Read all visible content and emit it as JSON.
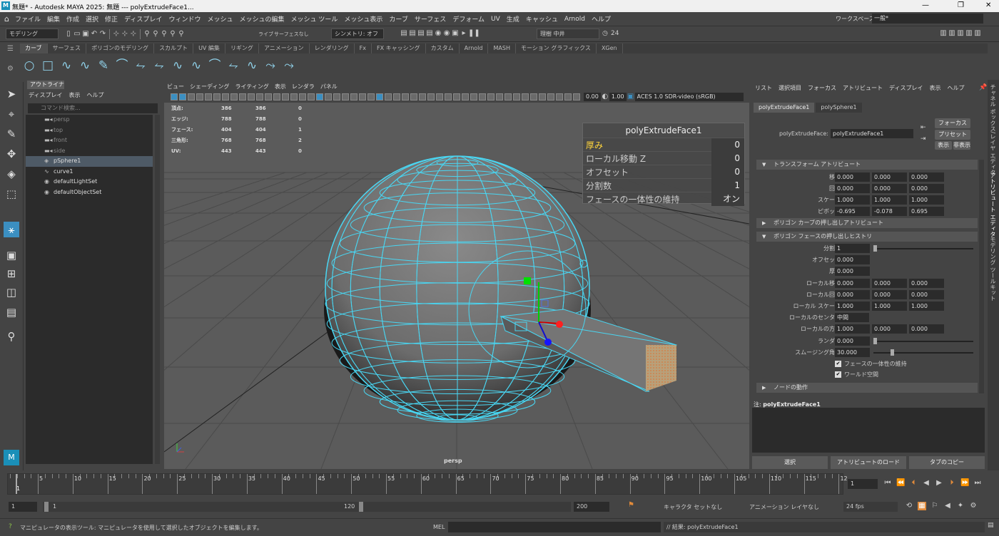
{
  "window": {
    "title": "無題* - Autodesk MAYA 2025: 無題   ---   polyExtrudeFace1...",
    "logo": "M",
    "min": "—",
    "max": "❐",
    "close": "✕"
  },
  "menubar": [
    "ファイル",
    "編集",
    "作成",
    "選択",
    "修正",
    "ディスプレイ",
    "ウィンドウ",
    "メッシュ",
    "メッシュの編集",
    "メッシュ ツール",
    "メッシュ表示",
    "カーブ",
    "サーフェス",
    "デフォーム",
    "UV",
    "生成",
    "キャッシュ",
    "Arnold",
    "ヘルプ"
  ],
  "workspace": {
    "label": "ワークスペース :",
    "value": "一般*"
  },
  "statusline": {
    "menuset": "モデリング",
    "live": "ライブ",
    "live_value": "サーフェスなし",
    "symmetry": "シンメトリ: オフ",
    "user": "理樹 中井",
    "count": "24"
  },
  "shelf": {
    "tabs": [
      "カーブ",
      "サーフェス",
      "ポリゴンのモデリング",
      "スカルプト",
      "UV 編集",
      "リギング",
      "アニメーション",
      "レンダリング",
      "Fx",
      "FX キャッシング",
      "カスタム",
      "Arnold",
      "MASH",
      "モーション グラフィックス",
      "XGen"
    ]
  },
  "outliner": {
    "tab": "アウトライナ",
    "menus": [
      "ディスプレイ",
      "表示",
      "ヘルプ"
    ],
    "search_placeholder": "コマンド検索...",
    "items": [
      {
        "name": "persp",
        "dim": true
      },
      {
        "name": "top",
        "dim": true
      },
      {
        "name": "front",
        "dim": true
      },
      {
        "name": "side",
        "dim": true
      },
      {
        "name": "pSphere1",
        "dim": false,
        "selected": true
      },
      {
        "name": "curve1",
        "dim": false
      },
      {
        "name": "defaultLightSet",
        "dim": false
      },
      {
        "name": "defaultObjectSet",
        "dim": false
      }
    ]
  },
  "viewport": {
    "menus": [
      "ビュー",
      "シェーディング",
      "ライティング",
      "表示",
      "レンダラ",
      "パネル"
    ],
    "exposure": "0.00",
    "gamma": "1.00",
    "colorspace": "ACES 1.0 SDR-video (sRGB)",
    "camera": "persp",
    "hud": [
      [
        "頂点:",
        "386",
        "386",
        "0"
      ],
      [
        "エッジ:",
        "788",
        "788",
        "0"
      ],
      [
        "フェース:",
        "404",
        "404",
        "1"
      ],
      [
        "三角形:",
        "768",
        "768",
        "2"
      ],
      [
        "UV:",
        "443",
        "443",
        "0"
      ]
    ]
  },
  "inview_editor": {
    "title": "polyExtrudeFace1",
    "rows": [
      {
        "label": "厚み",
        "value": "0",
        "highlight": true
      },
      {
        "label": "ローカル移動 Z",
        "value": "0"
      },
      {
        "label": "オフセット",
        "value": "0"
      },
      {
        "label": "分割数",
        "value": "1"
      },
      {
        "label": "フェースの一体性の維持",
        "value": "オン"
      }
    ]
  },
  "attribute_editor": {
    "menus": [
      "リスト",
      "選択項目",
      "フォーカス",
      "アトリビュート",
      "ディスプレイ",
      "表示",
      "ヘルプ"
    ],
    "tabs": [
      "polyExtrudeFace1",
      "polySphere1"
    ],
    "node_label": "polyExtrudeFace:",
    "node_value": "polyExtrudeFace1",
    "focus_btn": "フォーカス",
    "preset_btn": "プリセット",
    "show_btn": "表示",
    "hide_btn": "非表示",
    "sections": {
      "transform": "トランスフォーム アトリビュート",
      "curve": "ポリゴン カーブの押し出しアトリビュート",
      "history": "ポリゴン フェースの押し出しヒストリ",
      "node": "ノードの動作"
    },
    "transform": [
      {
        "label": "移動",
        "v": [
          "0.000",
          "0.000",
          "0.000"
        ]
      },
      {
        "label": "回転",
        "v": [
          "0.000",
          "0.000",
          "0.000"
        ]
      },
      {
        "label": "スケール",
        "v": [
          "1.000",
          "1.000",
          "1.000"
        ]
      },
      {
        "label": "ピボット",
        "v": [
          "-0.695",
          "-0.078",
          "0.695"
        ]
      }
    ],
    "history": [
      {
        "label": "分割数",
        "v": [
          "1"
        ],
        "slider": true,
        "level": 0.0
      },
      {
        "label": "オフセット",
        "v": [
          "0.000"
        ]
      },
      {
        "label": "厚み",
        "v": [
          "0.000"
        ]
      },
      {
        "label": "ローカル移動",
        "v": [
          "0.000",
          "0.000",
          "0.000"
        ]
      },
      {
        "label": "ローカル回転",
        "v": [
          "0.000",
          "0.000",
          "0.000"
        ]
      },
      {
        "label": "ローカル スケール",
        "v": [
          "1.000",
          "1.000",
          "1.000"
        ]
      },
      {
        "label": "ローカルのセンター",
        "v": [
          "中間"
        ],
        "dropdown": true
      },
      {
        "label": "ローカルの方向",
        "v": [
          "1.000",
          "0.000",
          "0.000"
        ]
      },
      {
        "label": "ランダム",
        "v": [
          "0.000"
        ],
        "slider": true,
        "level": 0.0
      },
      {
        "label": "スムージング角度",
        "v": [
          "30.000"
        ],
        "slider": true,
        "level": 0.17
      }
    ],
    "checks": [
      "フェースの一体性の維持",
      "ワールド空間"
    ],
    "note_label": "注:",
    "note_value": "polyExtrudeFace1",
    "bottom": [
      "選択",
      "アトリビュートのロード",
      "タブのコピー"
    ]
  },
  "right_tabs": [
    "チャネル ボックス/レイヤ エディタ",
    "アトリビュート エディタ",
    "モデリング ツールキット"
  ],
  "timeline": {
    "ticks": [
      "5",
      "10",
      "15",
      "20",
      "25",
      "30",
      "35",
      "40",
      "45",
      "50",
      "55",
      "60",
      "65",
      "70",
      "75",
      "80",
      "85",
      "90",
      "95",
      "100",
      "105",
      "110",
      "115",
      "12"
    ],
    "current": "1",
    "frame_field": "1"
  },
  "range": {
    "start": "1",
    "inner_start": "1",
    "inner_end": "120",
    "end": "200",
    "character": "キャラクタ セットなし",
    "anim_layer": "アニメーション レイヤなし",
    "fps": "24 fps"
  },
  "cmd": {
    "help": "マニピュレータの表示ツール: マニピュレータを使用して選択したオブジェクトを編集します。",
    "lang": "MEL",
    "result": "// 結果: polyExtrudeFace1"
  },
  "colors": {
    "wire": "#49d6f2",
    "bg": "#444444",
    "field": "#2b2b2b"
  }
}
